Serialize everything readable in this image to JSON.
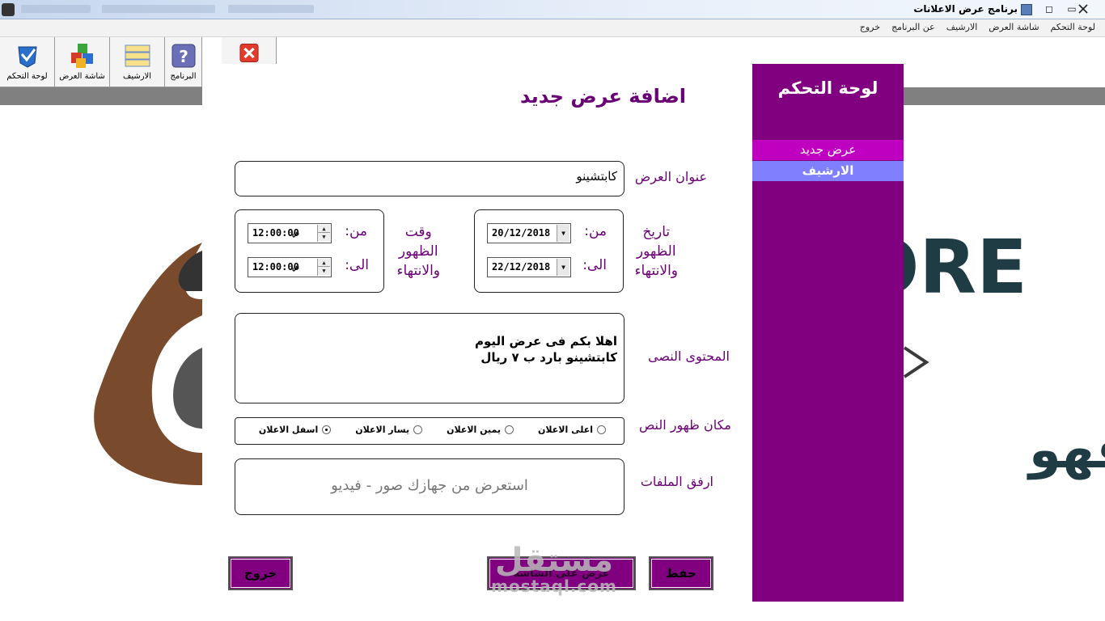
{
  "window": {
    "title": "برنامج عرض الاعلانات",
    "buttons": {
      "minimize": "▭",
      "maximize": "◻",
      "close": "☒"
    }
  },
  "menu": [
    "لوحة التحكم",
    "شاشة العرض",
    "الارشيف",
    "عن البرنامج",
    "خروج"
  ],
  "toolbar": [
    {
      "label": "لوحة التحكم",
      "icon": "control-panel-icon"
    },
    {
      "label": "شاشة العرض",
      "icon": "display-blocks-icon"
    },
    {
      "label": "الارشيف",
      "icon": "archive-icon"
    },
    {
      "label": "البرنامج",
      "icon": "help-question-icon"
    },
    {
      "label": "",
      "icon": "exit-close-icon"
    }
  ],
  "background": {
    "visible_text": [
      "ORE",
      "قهو"
    ]
  },
  "form": {
    "page_title": "اضافة عرض جديد",
    "title_label": "عنوان العرض",
    "title_value": "كابتشينو",
    "date_label": [
      "تاريخ",
      "الظهور",
      "والانتهاء"
    ],
    "from_label": "من:",
    "to_label": "الى:",
    "date_from": "20/12/2018",
    "date_to": "22/12/2018",
    "time_label": [
      "وقت",
      "الظهور",
      "والانتهاء"
    ],
    "time_from": "12:00:00",
    "time_to": "12:00:00",
    "ampm": "ص",
    "content_label": "المحتوى النصى",
    "content_lines": [
      "اهلا بكم فى عرض اليوم",
      "كابتشينو بارد ب ٧ ريال"
    ],
    "position_label": "مكان ظهور النص",
    "position_options": [
      {
        "label": "اعلى الاعلان",
        "checked": false
      },
      {
        "label": "يمين الاعلان",
        "checked": false
      },
      {
        "label": "يسار الاعلان",
        "checked": false
      },
      {
        "label": "اسفل الاعلان",
        "checked": true
      }
    ],
    "attach_label": "ارفق الملفات",
    "attach_hint": "استعرض من جهازك صور - فيديو",
    "buttons": {
      "save": "حفظ",
      "preview": "عرض على الشاشة",
      "exit": "خروج"
    }
  },
  "sidebar": {
    "title": "لوحة التحكم",
    "items": [
      "عرض جديد",
      "الارشيف"
    ]
  },
  "watermark": {
    "arabic": "مستقل",
    "latin": "mostaql.com"
  },
  "colors": {
    "primary_purple": "#800080",
    "label_purple": "#6a0076",
    "active_item": "#c000c0",
    "archive_item": "#8080ff"
  }
}
